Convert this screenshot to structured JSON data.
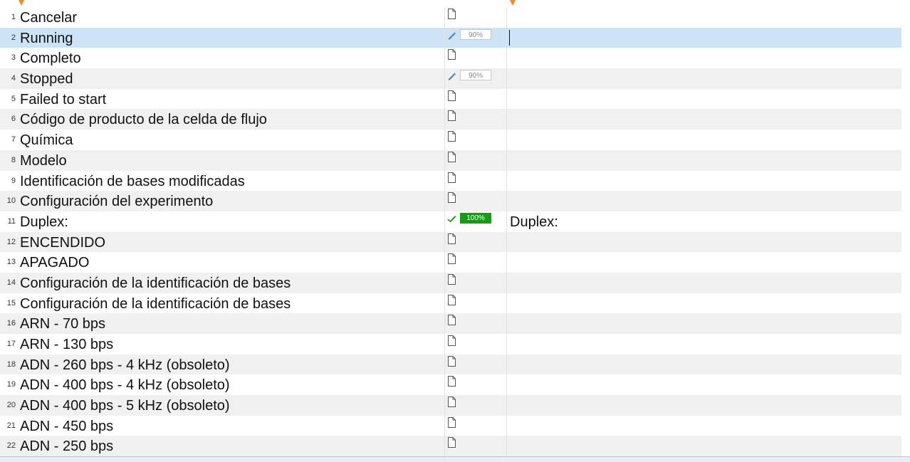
{
  "editor": {
    "rows": [
      {
        "num": "1",
        "source": "Cancelar",
        "status": "new",
        "target": ""
      },
      {
        "num": "2",
        "source": "Running",
        "status": "fuzzy",
        "match": "90%",
        "target": "",
        "selected": true
      },
      {
        "num": "3",
        "source": "Completo",
        "status": "new",
        "target": ""
      },
      {
        "num": "4",
        "source": "Stopped",
        "status": "fuzzy",
        "match": "90%",
        "target": ""
      },
      {
        "num": "5",
        "source": "Failed to start",
        "status": "new",
        "target": ""
      },
      {
        "num": "6",
        "source": "Código de producto de la celda de flujo",
        "status": "new",
        "target": ""
      },
      {
        "num": "7",
        "source": "Química",
        "status": "new",
        "target": ""
      },
      {
        "num": "8",
        "source": "Modelo",
        "status": "new",
        "target": ""
      },
      {
        "num": "9",
        "source": "Identificación de bases modificadas",
        "status": "new",
        "target": ""
      },
      {
        "num": "10",
        "source": "Configuración del experimento",
        "status": "new",
        "target": ""
      },
      {
        "num": "11",
        "source": "Duplex:",
        "status": "translated",
        "match": "100%",
        "target": "Duplex:"
      },
      {
        "num": "12",
        "source": "ENCENDIDO",
        "status": "new",
        "target": ""
      },
      {
        "num": "13",
        "source": "APAGADO",
        "status": "new",
        "target": ""
      },
      {
        "num": "14",
        "source": "Configuración de la identificación de bases",
        "status": "new",
        "target": ""
      },
      {
        "num": "15",
        "source": "Configuración de la identificación de bases",
        "status": "new",
        "target": ""
      },
      {
        "num": "16",
        "source": "ARN - 70 bps",
        "status": "new",
        "target": ""
      },
      {
        "num": "17",
        "source": "ARN - 130 bps",
        "status": "new",
        "target": ""
      },
      {
        "num": "18",
        "source": "ADN - 260 bps - 4 kHz (obsoleto)",
        "status": "new",
        "target": ""
      },
      {
        "num": "19",
        "source": "ADN - 400 bps - 4 kHz (obsoleto)",
        "status": "new",
        "target": ""
      },
      {
        "num": "20",
        "source": "ADN - 400 bps - 5 kHz (obsoleto)",
        "status": "new",
        "target": ""
      },
      {
        "num": "21",
        "source": "ADN - 450 bps",
        "status": "new",
        "target": ""
      },
      {
        "num": "22",
        "source": "ADN - 250 bps",
        "status": "new",
        "target": ""
      }
    ]
  },
  "icons": {
    "new": "document-icon",
    "fuzzy": "pencil-icon",
    "translated": "pencil-check-icon"
  },
  "colors": {
    "selected_row": "#cde4f7",
    "alt_row": "#f0f0f0",
    "match_full": "#10a010",
    "marker": "#f08a24"
  }
}
